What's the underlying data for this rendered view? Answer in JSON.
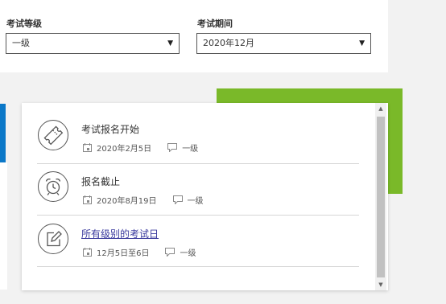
{
  "filters": {
    "level_label": "考试等级",
    "level_value": "一级",
    "period_label": "考试期间",
    "period_value": "2020年12月",
    "arrow_glyph": "▼"
  },
  "events": [
    {
      "icon": "ticket-icon",
      "title": "考试报名开始",
      "date": "2020年2月5日",
      "level": "一级",
      "is_link": false
    },
    {
      "icon": "alarm-clock-icon",
      "title": "报名截止",
      "date": "2020年8月19日",
      "level": "一级",
      "is_link": false
    },
    {
      "icon": "edit-icon",
      "title": "所有级别的考试日",
      "date": "12月5日至6日",
      "level": "一级",
      "is_link": true
    }
  ],
  "colors": {
    "green_accent": "#7ab929",
    "blue_accent": "#0b78c8",
    "link": "#3b3b9e"
  },
  "scrollbar": {
    "up_glyph": "▲",
    "down_glyph": "▼"
  }
}
